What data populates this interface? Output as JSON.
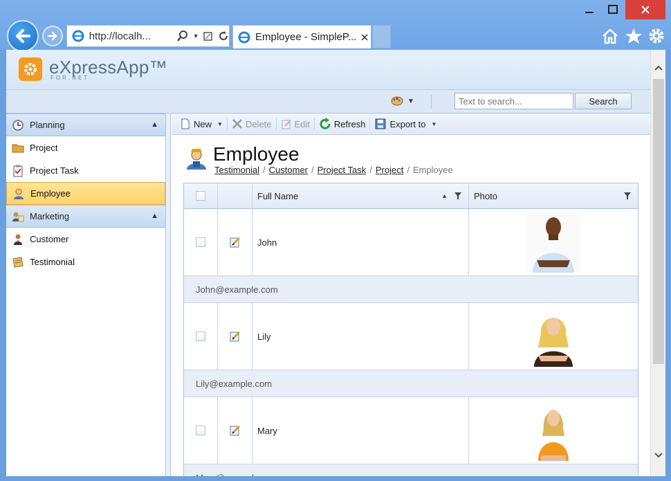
{
  "browser": {
    "address": "http://localh...",
    "tab_title": "Employee - SimpleP...",
    "window_controls": [
      "minimize",
      "maximize",
      "close"
    ]
  },
  "header": {
    "logo_text": "eXpressApp™",
    "logo_sub": "FOR.NET"
  },
  "search": {
    "placeholder": "Text to search...",
    "button_label": "Search"
  },
  "nav": {
    "groups": [
      {
        "label": "Planning",
        "items": [
          {
            "label": "Project",
            "icon": "folder-icon"
          },
          {
            "label": "Project Task",
            "icon": "task-icon"
          },
          {
            "label": "Employee",
            "icon": "employee-icon",
            "selected": true
          }
        ]
      },
      {
        "label": "Marketing",
        "items": [
          {
            "label": "Customer",
            "icon": "customer-icon"
          },
          {
            "label": "Testimonial",
            "icon": "testimonial-icon"
          }
        ]
      }
    ]
  },
  "toolbar": {
    "new_label": "New",
    "delete_label": "Delete",
    "edit_label": "Edit",
    "refresh_label": "Refresh",
    "export_label": "Export to"
  },
  "view": {
    "title": "Employee",
    "breadcrumb": [
      "Testimonial",
      "Customer",
      "Project Task",
      "Project"
    ],
    "breadcrumb_current": "Employee"
  },
  "grid": {
    "columns": {
      "name": "Full Name",
      "photo": "Photo"
    },
    "rows": [
      {
        "name": "John",
        "email": "John@example.com"
      },
      {
        "name": "Lily",
        "email": "Lily@example.com"
      },
      {
        "name": "Mary",
        "email": "Mary@example.com"
      }
    ]
  },
  "colors": {
    "accent": "#6aa0e0",
    "selection": "#ffd36a",
    "logo": "#f39a21"
  }
}
